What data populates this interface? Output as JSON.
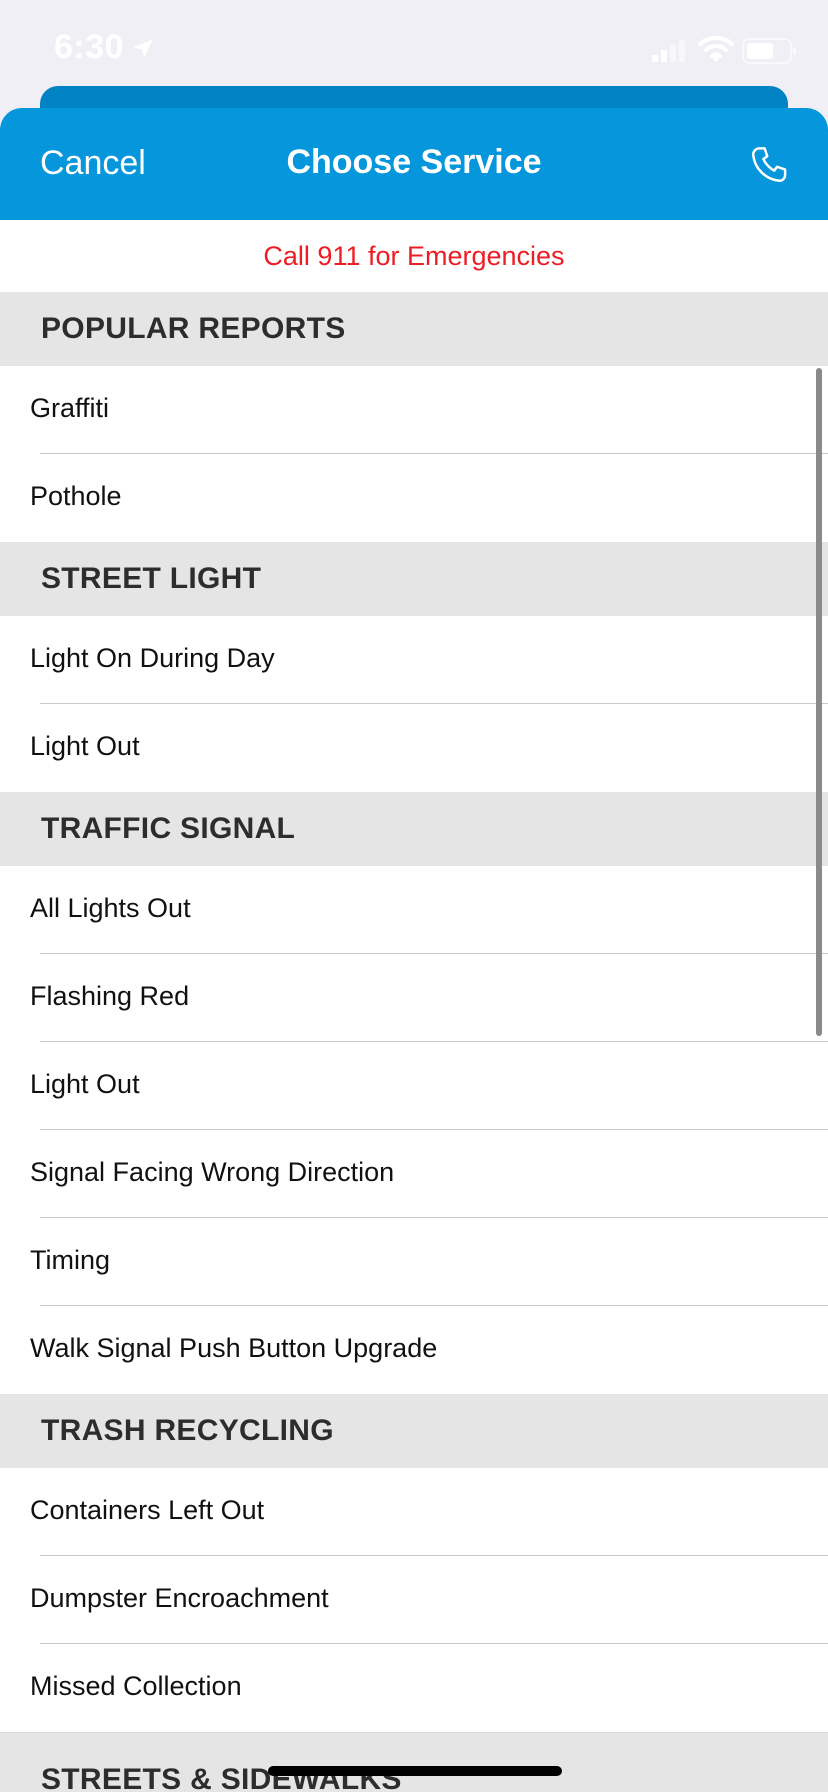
{
  "status_bar": {
    "time": "6:30"
  },
  "nav": {
    "cancel_label": "Cancel",
    "title": "Choose Service",
    "call_icon": "phone-icon"
  },
  "emergency_notice": "Call 911 for Emergencies",
  "sections": [
    {
      "header": "POPULAR REPORTS",
      "items": [
        "Graffiti",
        "Pothole"
      ]
    },
    {
      "header": "STREET LIGHT",
      "items": [
        "Light On During Day",
        "Light Out"
      ]
    },
    {
      "header": "TRAFFIC SIGNAL",
      "items": [
        "All Lights Out",
        "Flashing Red",
        "Light Out",
        "Signal Facing Wrong Direction",
        "Timing",
        "Walk Signal Push Button Upgrade"
      ]
    },
    {
      "header": "TRASH RECYCLING",
      "items": [
        "Containers Left Out",
        "Dumpster Encroachment",
        "Missed Collection"
      ]
    },
    {
      "header": "STREETS & SIDEWALKS",
      "items": []
    }
  ],
  "colors": {
    "nav_background": "#0596dc",
    "emergency_text": "#ee1c24",
    "section_header_background": "#e5e5e5"
  }
}
